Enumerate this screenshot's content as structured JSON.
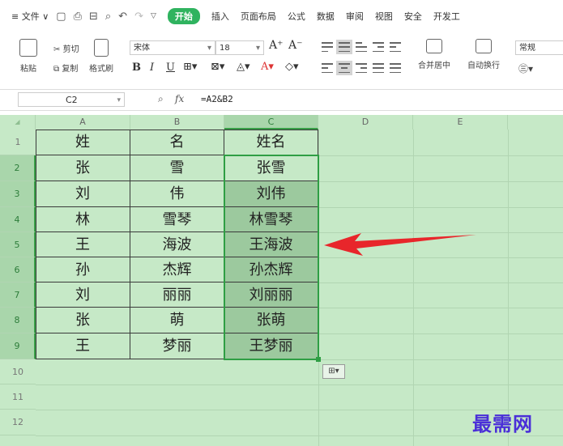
{
  "menu": {
    "file_label": "≡ 文件 ∨",
    "start_label": "开始",
    "tabs": [
      "插入",
      "页面布局",
      "公式",
      "数据",
      "审阅",
      "视图",
      "安全",
      "开发工"
    ]
  },
  "ribbon": {
    "paste_label": "粘贴",
    "cut_label": "剪切",
    "copy_label": "复制",
    "format_painter_label": "格式刷",
    "font_name": "宋体",
    "font_size": "18",
    "merge_label": "合并居中",
    "wrap_label": "自动换行",
    "number_format": "常规"
  },
  "formula_bar": {
    "cell_ref": "C2",
    "formula": "=A2&B2"
  },
  "sheet": {
    "columns": [
      "A",
      "B",
      "C",
      "D",
      "E"
    ],
    "rows": [
      "1",
      "2",
      "3",
      "4",
      "5",
      "6",
      "7",
      "8",
      "9",
      "10",
      "11",
      "12"
    ],
    "data": [
      [
        "姓",
        "名",
        "姓名"
      ],
      [
        "张",
        "雪",
        "张雪"
      ],
      [
        "刘",
        "伟",
        "刘伟"
      ],
      [
        "林",
        "雪琴",
        "林雪琴"
      ],
      [
        "王",
        "海波",
        "王海波"
      ],
      [
        "孙",
        "杰辉",
        "孙杰辉"
      ],
      [
        "刘",
        "丽丽",
        "刘丽丽"
      ],
      [
        "张",
        "萌",
        "张萌"
      ],
      [
        "王",
        "梦丽",
        "王梦丽"
      ]
    ]
  },
  "watermark": "最需网",
  "colors": {
    "sheet_bg": "#c6e9c7",
    "selection": "#2f9e44",
    "arrow": "#e8262b",
    "start_tab": "#2fb35f"
  }
}
